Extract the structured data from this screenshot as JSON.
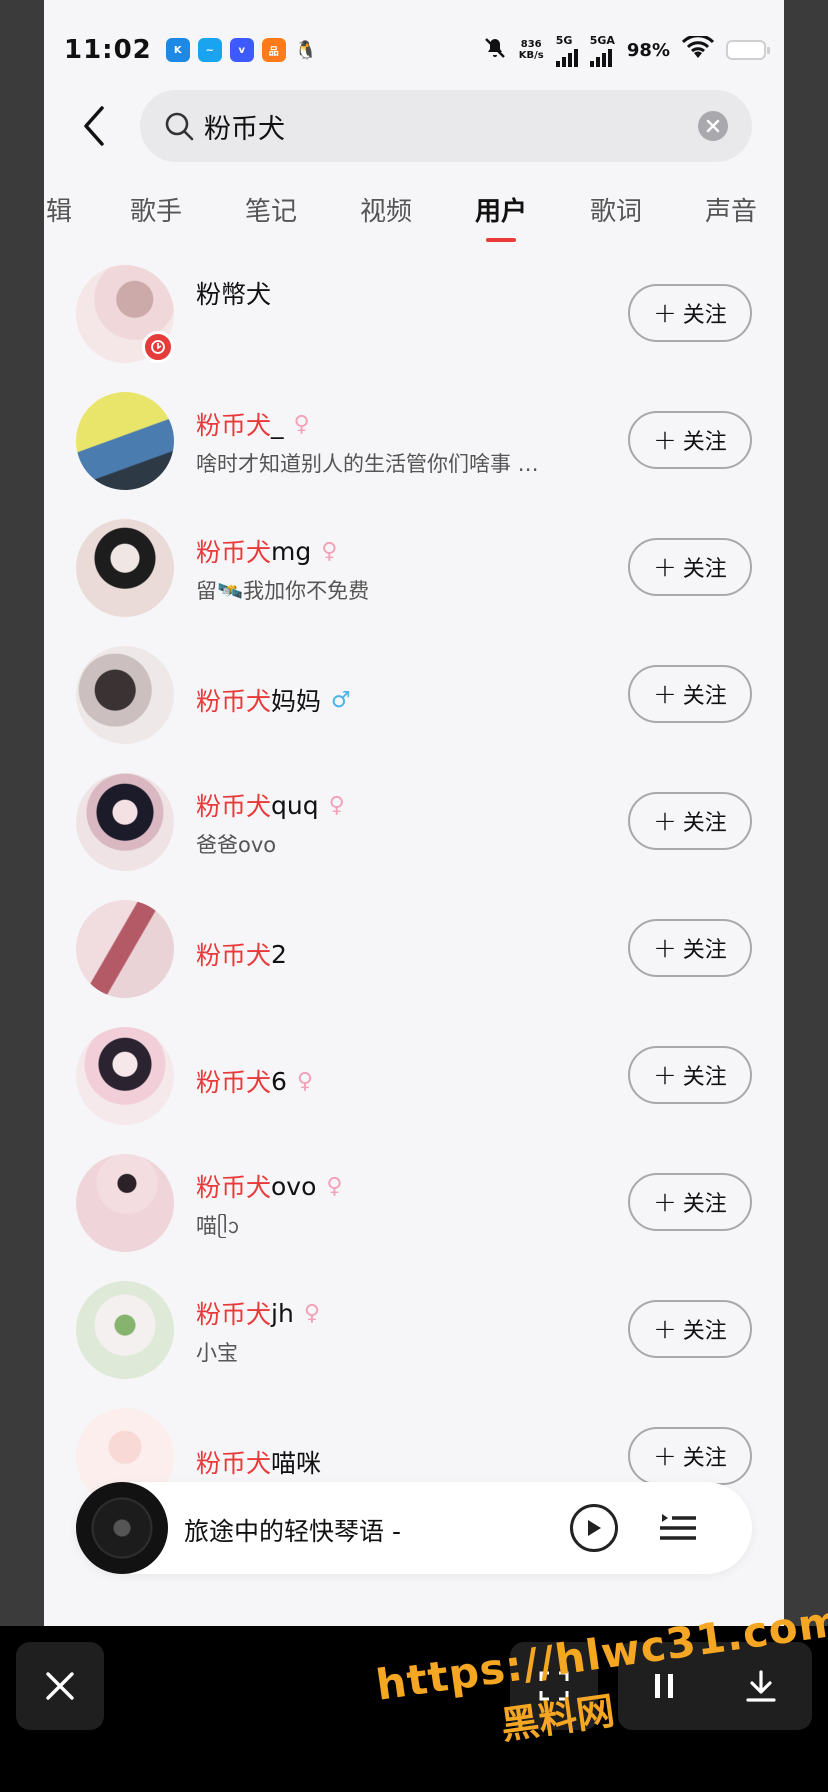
{
  "status_bar": {
    "time": "11:02",
    "net_speed": "836",
    "net_unit": "KB/s",
    "network_1": "5G",
    "network_2": "5GA",
    "battery": "98%"
  },
  "search": {
    "query": "粉币犬"
  },
  "tabs": [
    {
      "label": "辑"
    },
    {
      "label": "歌手"
    },
    {
      "label": "笔记"
    },
    {
      "label": "视频"
    },
    {
      "label": "用户"
    },
    {
      "label": "歌词"
    },
    {
      "label": "声音"
    }
  ],
  "follow_label": "关注",
  "users": [
    {
      "highlight": "",
      "rest": "粉幣犬",
      "gender": "",
      "desc": ""
    },
    {
      "highlight": "粉币犬",
      "rest": "_",
      "gender": "♀",
      "desc": "啥时才知道别人的生活管你们啥事 …"
    },
    {
      "highlight": "粉币犬",
      "rest": "mg",
      "gender": "♀",
      "desc": "留🛰️我加你不免费"
    },
    {
      "highlight": "粉币犬",
      "rest": "妈妈",
      "gender": "♂",
      "desc": ""
    },
    {
      "highlight": "粉币犬",
      "rest": "quq",
      "gender": "♀",
      "desc": "爸爸ovo"
    },
    {
      "highlight": "粉币犬",
      "rest": "2",
      "gender": "",
      "desc": ""
    },
    {
      "highlight": "粉币犬",
      "rest": "6",
      "gender": "♀",
      "desc": ""
    },
    {
      "highlight": "粉币犬",
      "rest": "ovo",
      "gender": "♀",
      "desc": "喵ᥫᩣ"
    },
    {
      "highlight": "粉币犬",
      "rest": "jh",
      "gender": "♀",
      "desc": "小宝"
    },
    {
      "highlight": "粉币犬",
      "rest": "喵咪",
      "gender": "",
      "desc": ""
    }
  ],
  "player": {
    "song": "旅途中的轻快琴语 -"
  },
  "watermark": {
    "url": "https://hlwc31.com",
    "site": "黑料网"
  },
  "colors": {
    "accent": "#e83a3a",
    "female": "#f2a3b8",
    "male": "#49b5e8"
  }
}
